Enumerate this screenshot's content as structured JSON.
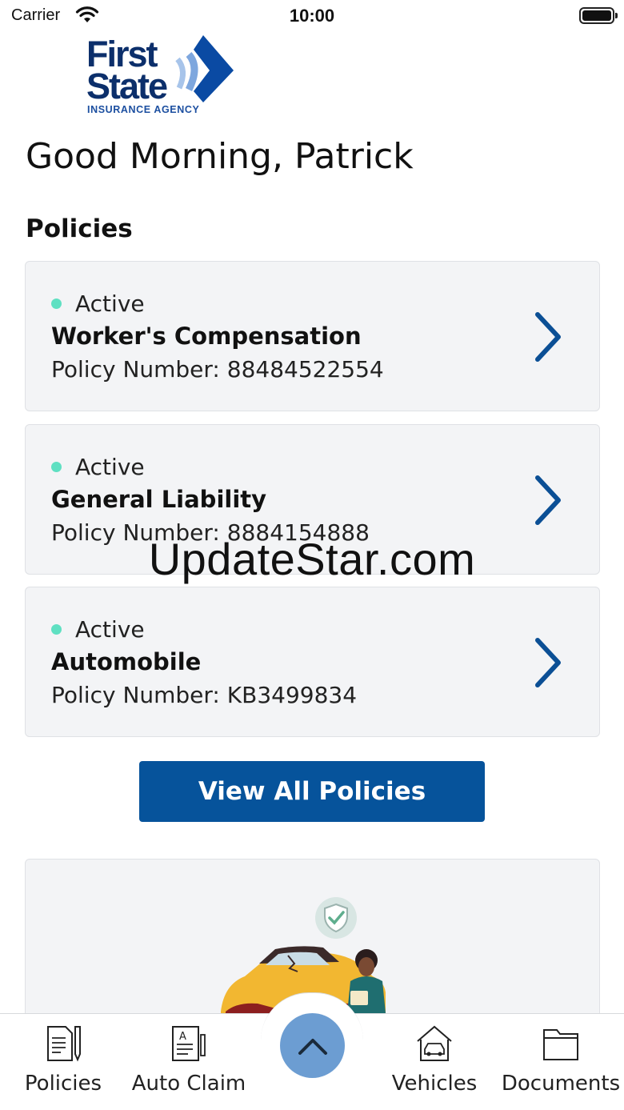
{
  "status_bar": {
    "carrier": "Carrier",
    "time": "10:00"
  },
  "logo": {
    "line1": "First",
    "line2": "State",
    "line3": "INSURANCE AGENCY"
  },
  "greeting": "Good Morning, Patrick",
  "policies_section": {
    "title": "Policies",
    "items": [
      {
        "status": "Active",
        "name": "Worker's Compensation",
        "policy_number": "Policy Number: 88484522554"
      },
      {
        "status": "Active",
        "name": "General Liability",
        "policy_number": "Policy Number: 8884154888"
      },
      {
        "status": "Active",
        "name": "Automobile",
        "policy_number": "Policy Number: KB3499834"
      }
    ],
    "view_all_label": "View All Policies"
  },
  "watermark": "UpdateStar.com",
  "tab_bar": {
    "items": [
      {
        "label": "Policies",
        "icon": "policy-document-icon"
      },
      {
        "label": "Auto Claim",
        "icon": "claim-form-icon"
      },
      {
        "label": "Vehicles",
        "icon": "garage-car-icon"
      },
      {
        "label": "Documents",
        "icon": "folder-icon"
      }
    ],
    "center_button_icon": "chevron-up-icon"
  },
  "colors": {
    "brand_blue": "#06539b",
    "active_dot": "#5fe0c2",
    "fab": "#6c9dd2",
    "card_bg": "#f3f4f6"
  }
}
